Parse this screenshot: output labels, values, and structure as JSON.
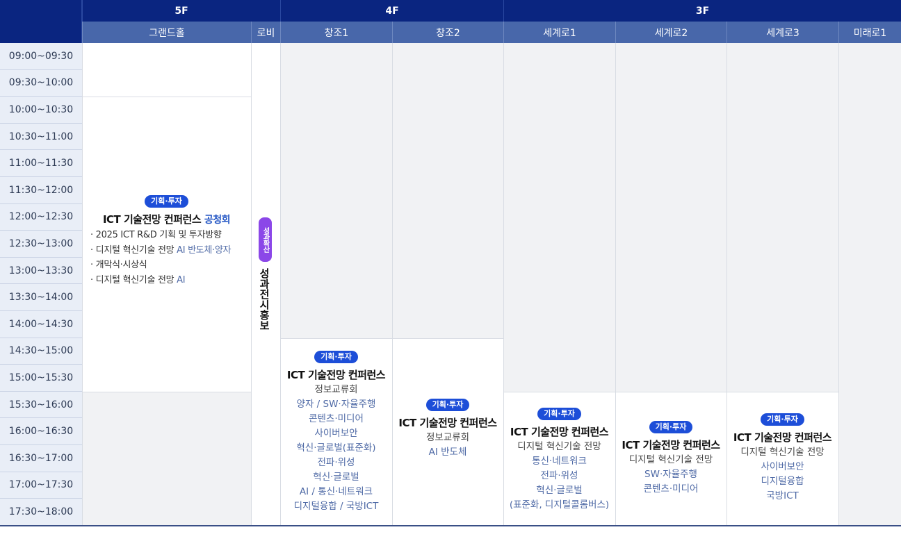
{
  "floors": [
    "5F",
    "4F",
    "3F"
  ],
  "rooms": [
    "그랜드홀",
    "로비",
    "창조1",
    "창조2",
    "세계로1",
    "세계로2",
    "세계로3",
    "미래로1"
  ],
  "times": [
    "09:00~09:30",
    "09:30~10:00",
    "10:00~10:30",
    "10:30~11:00",
    "11:00~11:30",
    "11:30~12:00",
    "12:00~12:30",
    "12:30~13:00",
    "13:00~13:30",
    "13:30~14:00",
    "14:00~14:30",
    "14:30~15:00",
    "15:00~15:30",
    "15:30~16:00",
    "16:00~16:30",
    "16:30~17:00",
    "17:00~17:30",
    "17:30~18:00"
  ],
  "lobby": {
    "badge": "성과확산",
    "title": "성과전시홍보"
  },
  "grand_hall": {
    "badge": "기획·투자",
    "title": "ICT 기술전망 컨퍼런스",
    "title_accent": "공청회",
    "bullets": [
      {
        "text": "2025 ICT R&D 기획 및 투자방향",
        "accent": ""
      },
      {
        "text": "디지털 혁신기술 전망 ",
        "accent": "AI 반도체·양자"
      },
      {
        "text": "개막식·시상식",
        "accent": ""
      },
      {
        "text": "디지털 혁신기술 전망 ",
        "accent": "AI"
      }
    ]
  },
  "changjo1": {
    "badge": "기획·투자",
    "title": "ICT 기술전망 컨퍼런스",
    "lines": [
      {
        "text": "정보교류회",
        "blue": false
      },
      {
        "text": "양자 / SW·자율주행",
        "blue": true
      },
      {
        "text": "콘텐츠·미디어",
        "blue": true
      },
      {
        "text": "사이버보안",
        "blue": true
      },
      {
        "text": "혁신·글로벌(표준화)",
        "blue": true
      },
      {
        "text": "전파·위성",
        "blue": true
      },
      {
        "text": "혁신·글로벌",
        "blue": true
      },
      {
        "text": "AI / 통신·네트워크",
        "blue": true
      },
      {
        "text": "디지털융합 / 국방ICT",
        "blue": true
      }
    ]
  },
  "changjo2": {
    "badge": "기획·투자",
    "title": "ICT 기술전망 컨퍼런스",
    "lines": [
      {
        "text": "정보교류회",
        "blue": false
      },
      {
        "text": "AI 반도체",
        "blue": true
      }
    ]
  },
  "segyero1": {
    "badge": "기획·투자",
    "title": "ICT 기술전망 컨퍼런스",
    "lines": [
      {
        "text": "디지털 혁신기술 전망",
        "blue": false
      },
      {
        "text": "통신·네트워크",
        "blue": true
      },
      {
        "text": "전파·위성",
        "blue": true
      },
      {
        "text": "혁신·글로벌",
        "blue": true
      },
      {
        "text": "(표준화, 디지털콜롬버스)",
        "blue": true
      }
    ]
  },
  "segyero2": {
    "badge": "기획·투자",
    "title": "ICT 기술전망 컨퍼런스",
    "lines": [
      {
        "text": "디지털 혁신기술 전망",
        "blue": false
      },
      {
        "text": "SW·자율주행",
        "blue": true
      },
      {
        "text": "콘텐츠·미디어",
        "blue": true
      }
    ]
  },
  "segyero3": {
    "badge": "기획·투자",
    "title": "ICT 기술전망 컨퍼런스",
    "lines": [
      {
        "text": "디지털 혁신기술 전망",
        "blue": false
      },
      {
        "text": "사이버보안",
        "blue": true
      },
      {
        "text": "디지털융합",
        "blue": true
      },
      {
        "text": "국방ICT",
        "blue": true
      }
    ]
  }
}
